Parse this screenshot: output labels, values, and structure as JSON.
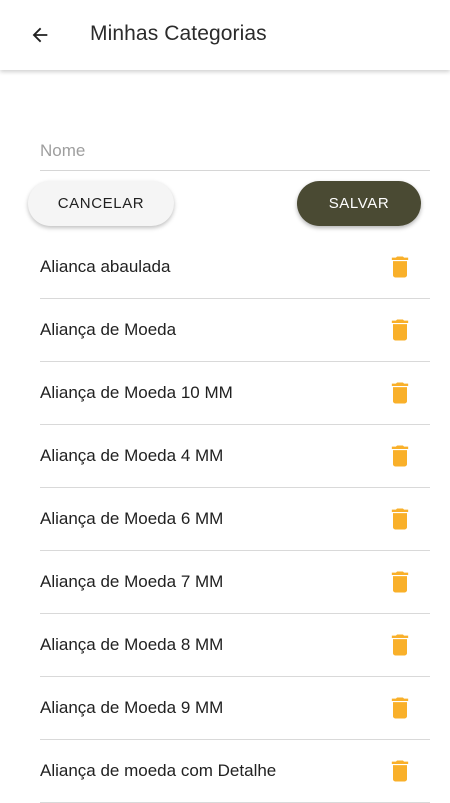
{
  "appbar": {
    "title": "Minhas Categorias",
    "back_icon": "arrow-back-icon"
  },
  "form": {
    "name_placeholder": "Nome",
    "name_value": "",
    "cancel_label": "CANCELAR",
    "save_label": "SALVAR"
  },
  "colors": {
    "save_button": "#4a4a33",
    "trash_icon": "#f9b02a"
  },
  "categories": [
    {
      "label": "Alianca abaulada",
      "icon": "trash-icon"
    },
    {
      "label": "Aliança de Moeda",
      "icon": "trash-icon"
    },
    {
      "label": "Aliança de Moeda 10 MM",
      "icon": "trash-icon"
    },
    {
      "label": "Aliança de Moeda 4 MM",
      "icon": "trash-icon"
    },
    {
      "label": "Aliança de Moeda 6 MM",
      "icon": "trash-icon"
    },
    {
      "label": "Aliança de Moeda 7 MM",
      "icon": "trash-icon"
    },
    {
      "label": "Aliança de Moeda 8 MM",
      "icon": "trash-icon"
    },
    {
      "label": "Aliança de Moeda 9 MM",
      "icon": "trash-icon"
    },
    {
      "label": "Aliança de moeda com Detalhe",
      "icon": "trash-icon"
    }
  ]
}
